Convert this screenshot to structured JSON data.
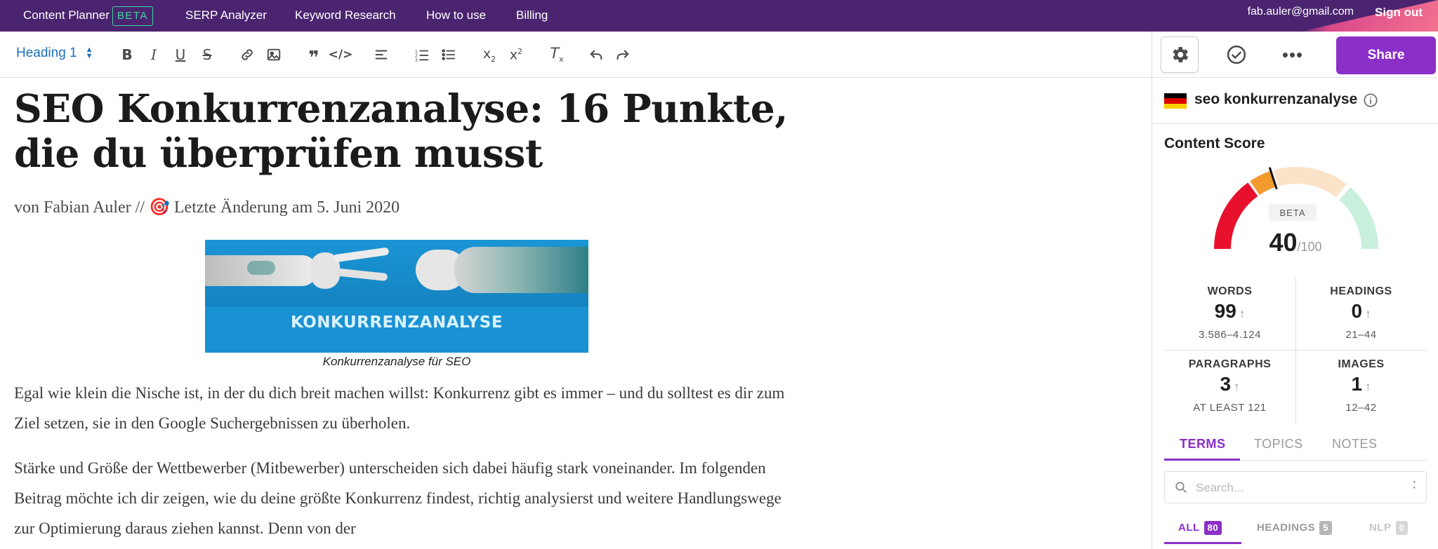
{
  "nav": {
    "app_name": "Content Planner",
    "app_badge": "BETA",
    "items": [
      {
        "label": "SERP Analyzer"
      },
      {
        "label": "Keyword Research"
      },
      {
        "label": "How to use"
      },
      {
        "label": "Billing"
      }
    ],
    "email": "fab.auler@gmail.com",
    "signout": "Sign out"
  },
  "toolbar": {
    "style_select": "Heading 1",
    "tools": [
      "bold-icon",
      "italic-icon",
      "underline-icon",
      "strikethrough-icon",
      "link-icon",
      "image-icon",
      "quote-icon",
      "code-icon",
      "align-left-icon",
      "ordered-list-icon",
      "bullet-list-icon",
      "subscript-icon",
      "superscript-icon",
      "clear-format-icon",
      "undo-icon",
      "redo-icon"
    ]
  },
  "document": {
    "title": "SEO Konkurrenzanalyse: 16 Punkte, die du überprüfen musst",
    "byline_author": "von Fabian Auler //",
    "byline_emoji": "🎯",
    "byline_date": "Letzte Änderung am 5. Juni 2020",
    "image_text": "KONKURRENZANALYSE",
    "caption": "Konkurrenzanalyse für SEO",
    "paragraph1": "Egal wie klein die Nische ist, in der du dich breit machen willst: Konkurrenz gibt es immer – und du solltest es dir zum Ziel setzen, sie in den Google Suchergebnissen zu überholen.",
    "paragraph2": "Stärke und Größe der Wettbewerber (Mitbewerber) unterscheiden sich dabei häufig stark voneinander. Im folgenden Beitrag möchte ich dir zeigen, wie du deine größte Konkurrenz findest, richtig analysierst und weitere Handlungswege zur Optimierung daraus ziehen kannst. Denn von der"
  },
  "panel": {
    "share_label": "Share",
    "more_label": "•••",
    "keyword": "seo konkurrenzanalyse",
    "flag_colors": [
      "#000000",
      "#dd0000",
      "#ffce00"
    ],
    "content_score_label": "Content Score",
    "gauge_badge": "BETA",
    "score": "40",
    "score_max": "/100",
    "score_value": 40,
    "gauge_colors": {
      "low": "#e8112d",
      "mid": "#f29a2e",
      "mid_light": "#fbe3c9",
      "high": "#c8f0dc",
      "needle": "#111111"
    },
    "metrics": [
      {
        "label": "WORDS",
        "value": "99",
        "arrow": "↑",
        "range": "3.586–4.124"
      },
      {
        "label": "HEADINGS",
        "value": "0",
        "arrow": "↑",
        "range": "21–44"
      },
      {
        "label": "PARAGRAPHS",
        "value": "3",
        "arrow": "↑",
        "range": "AT LEAST 121"
      },
      {
        "label": "IMAGES",
        "value": "1",
        "arrow": "↑",
        "range": "12–42"
      }
    ],
    "tabs": [
      {
        "label": "TERMS"
      },
      {
        "label": "TOPICS"
      },
      {
        "label": "NOTES"
      }
    ],
    "search_placeholder": "Search...",
    "filters": [
      {
        "label": "ALL",
        "count": "80"
      },
      {
        "label": "HEADINGS",
        "count": "5"
      },
      {
        "label": "NLP",
        "count": "0"
      }
    ],
    "accent": "#8b2fc9"
  }
}
